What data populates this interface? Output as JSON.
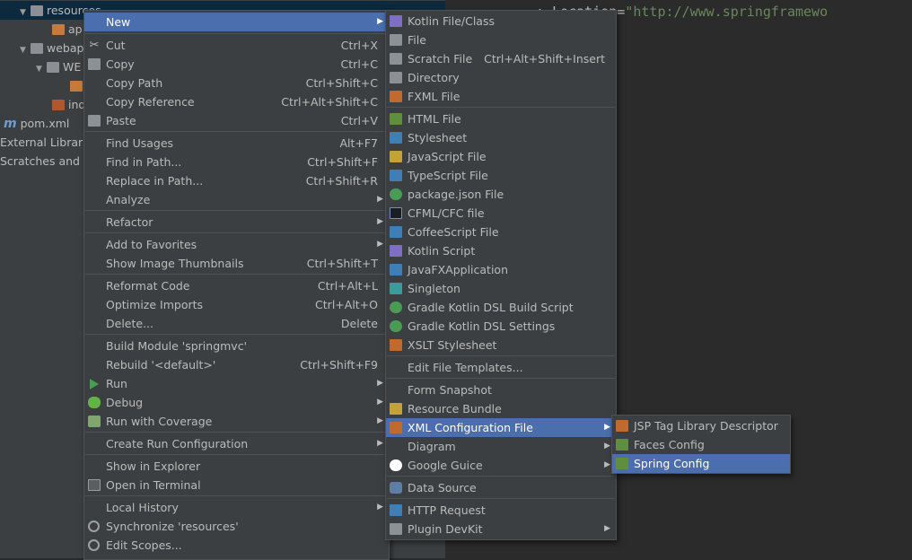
{
  "tree": {
    "items": [
      {
        "label": "resources",
        "arrow": "▼",
        "icon": "folder"
      },
      {
        "label": "ap",
        "arrow": "",
        "icon": "xml"
      },
      {
        "label": "webap",
        "arrow": "▼",
        "icon": "folder"
      },
      {
        "label": "WE",
        "arrow": "▼",
        "icon": "folder"
      },
      {
        "label": "",
        "arrow": "",
        "icon": "xml"
      },
      {
        "label": "ind",
        "arrow": "",
        "icon": "jsp"
      },
      {
        "label": "pom.xml",
        "arrow": "",
        "icon": "maven"
      },
      {
        "label": "External Librari",
        "arrow": "",
        "icon": "lib"
      },
      {
        "label": "Scratches and C",
        "arrow": "",
        "icon": "lib"
      }
    ]
  },
  "editor": {
    "code_prefix": ":    ",
    "code_attr": "Location=",
    "code_string": "\"http://www.springframewo"
  },
  "context_menu": {
    "items": [
      {
        "label": "New",
        "shortcut": "",
        "submenu": true,
        "icon": "",
        "highlighted": true
      },
      {
        "label": "Cut",
        "shortcut": "Ctrl+X",
        "submenu": false,
        "icon": "cut-icon"
      },
      {
        "label": "Copy",
        "shortcut": "Ctrl+C",
        "submenu": false,
        "icon": "copy-icon"
      },
      {
        "label": "Copy Path",
        "shortcut": "Ctrl+Shift+C",
        "submenu": false,
        "icon": ""
      },
      {
        "label": "Copy Reference",
        "shortcut": "Ctrl+Alt+Shift+C",
        "submenu": false,
        "icon": ""
      },
      {
        "label": "Paste",
        "shortcut": "Ctrl+V",
        "submenu": false,
        "icon": "paste-icon"
      },
      {
        "label": "Find Usages",
        "shortcut": "Alt+F7",
        "submenu": false,
        "icon": ""
      },
      {
        "label": "Find in Path...",
        "shortcut": "Ctrl+Shift+F",
        "submenu": false,
        "icon": ""
      },
      {
        "label": "Replace in Path...",
        "shortcut": "Ctrl+Shift+R",
        "submenu": false,
        "icon": ""
      },
      {
        "label": "Analyze",
        "shortcut": "",
        "submenu": true,
        "icon": ""
      },
      {
        "label": "Refactor",
        "shortcut": "",
        "submenu": true,
        "icon": ""
      },
      {
        "label": "Add to Favorites",
        "shortcut": "",
        "submenu": true,
        "icon": ""
      },
      {
        "label": "Show Image Thumbnails",
        "shortcut": "Ctrl+Shift+T",
        "submenu": false,
        "icon": ""
      },
      {
        "label": "Reformat Code",
        "shortcut": "Ctrl+Alt+L",
        "submenu": false,
        "icon": ""
      },
      {
        "label": "Optimize Imports",
        "shortcut": "Ctrl+Alt+O",
        "submenu": false,
        "icon": ""
      },
      {
        "label": "Delete...",
        "shortcut": "Delete",
        "submenu": false,
        "icon": ""
      },
      {
        "label": "Build Module 'springmvc'",
        "shortcut": "",
        "submenu": false,
        "icon": ""
      },
      {
        "label": "Rebuild '<default>'",
        "shortcut": "Ctrl+Shift+F9",
        "submenu": false,
        "icon": ""
      },
      {
        "label": "Run",
        "shortcut": "",
        "submenu": true,
        "icon": "run-icon"
      },
      {
        "label": "Debug",
        "shortcut": "",
        "submenu": true,
        "icon": "debug-icon"
      },
      {
        "label": "Run with Coverage",
        "shortcut": "",
        "submenu": true,
        "icon": "coverage-icon"
      },
      {
        "label": "Create Run Configuration",
        "shortcut": "",
        "submenu": true,
        "icon": ""
      },
      {
        "label": "Show in Explorer",
        "shortcut": "",
        "submenu": false,
        "icon": ""
      },
      {
        "label": "Open in Terminal",
        "shortcut": "",
        "submenu": false,
        "icon": "terminal-icon"
      },
      {
        "label": "Local History",
        "shortcut": "",
        "submenu": true,
        "icon": ""
      },
      {
        "label": "Synchronize 'resources'",
        "shortcut": "",
        "submenu": false,
        "icon": "sync-icon"
      },
      {
        "label": "Edit Scopes...",
        "shortcut": "",
        "submenu": false,
        "icon": "scope-icon"
      }
    ]
  },
  "new_menu": {
    "items": [
      {
        "label": "Kotlin File/Class",
        "shortcut": "",
        "submenu": false,
        "icon": "kotlin-file-icon"
      },
      {
        "label": "File",
        "shortcut": "",
        "submenu": false,
        "icon": "file-icon"
      },
      {
        "label": "Scratch File",
        "shortcut": "Ctrl+Alt+Shift+Insert",
        "submenu": false,
        "icon": "scratch-file-icon"
      },
      {
        "label": "Directory",
        "shortcut": "",
        "submenu": false,
        "icon": "directory-icon"
      },
      {
        "label": "FXML File",
        "shortcut": "",
        "submenu": false,
        "icon": "fxml-file-icon"
      },
      {
        "label": "HTML File",
        "shortcut": "",
        "submenu": false,
        "icon": "html-file-icon"
      },
      {
        "label": "Stylesheet",
        "shortcut": "",
        "submenu": false,
        "icon": "css-file-icon"
      },
      {
        "label": "JavaScript File",
        "shortcut": "",
        "submenu": false,
        "icon": "js-file-icon"
      },
      {
        "label": "TypeScript File",
        "shortcut": "",
        "submenu": false,
        "icon": "ts-file-icon"
      },
      {
        "label": "package.json File",
        "shortcut": "",
        "submenu": false,
        "icon": "nodejs-icon"
      },
      {
        "label": "CFML/CFC file",
        "shortcut": "",
        "submenu": false,
        "icon": "cfml-icon"
      },
      {
        "label": "CoffeeScript File",
        "shortcut": "",
        "submenu": false,
        "icon": "coffeescript-icon"
      },
      {
        "label": "Kotlin Script",
        "shortcut": "",
        "submenu": false,
        "icon": "kotlin-script-icon"
      },
      {
        "label": "JavaFXApplication",
        "shortcut": "",
        "submenu": false,
        "icon": "javafx-icon"
      },
      {
        "label": "Singleton",
        "shortcut": "",
        "submenu": false,
        "icon": "singleton-icon"
      },
      {
        "label": "Gradle Kotlin DSL Build Script",
        "shortcut": "",
        "submenu": false,
        "icon": "gradle-icon"
      },
      {
        "label": "Gradle Kotlin DSL Settings",
        "shortcut": "",
        "submenu": false,
        "icon": "gradle-icon"
      },
      {
        "label": "XSLT Stylesheet",
        "shortcut": "",
        "submenu": false,
        "icon": "xslt-icon"
      },
      {
        "label": "Edit File Templates...",
        "shortcut": "",
        "submenu": false,
        "icon": ""
      },
      {
        "label": "Form Snapshot",
        "shortcut": "",
        "submenu": false,
        "icon": ""
      },
      {
        "label": "Resource Bundle",
        "shortcut": "",
        "submenu": false,
        "icon": "resource-bundle-icon"
      },
      {
        "label": "XML Configuration File",
        "shortcut": "",
        "submenu": true,
        "icon": "xml-config-icon",
        "highlighted": true
      },
      {
        "label": "Diagram",
        "shortcut": "",
        "submenu": true,
        "icon": ""
      },
      {
        "label": "Google Guice",
        "shortcut": "",
        "submenu": true,
        "icon": "google-icon"
      },
      {
        "label": "Data Source",
        "shortcut": "",
        "submenu": false,
        "icon": "datasource-icon"
      },
      {
        "label": "HTTP Request",
        "shortcut": "",
        "submenu": false,
        "icon": "http-request-icon"
      },
      {
        "label": "Plugin DevKit",
        "shortcut": "",
        "submenu": true,
        "icon": "plugin-devkit-icon"
      }
    ]
  },
  "xml_menu": {
    "items": [
      {
        "label": "JSP Tag Library Descriptor",
        "icon": "tld-icon"
      },
      {
        "label": "Faces Config",
        "icon": "faces-config-icon"
      },
      {
        "label": "Spring Config",
        "icon": "spring-config-icon",
        "highlighted": true
      }
    ]
  }
}
